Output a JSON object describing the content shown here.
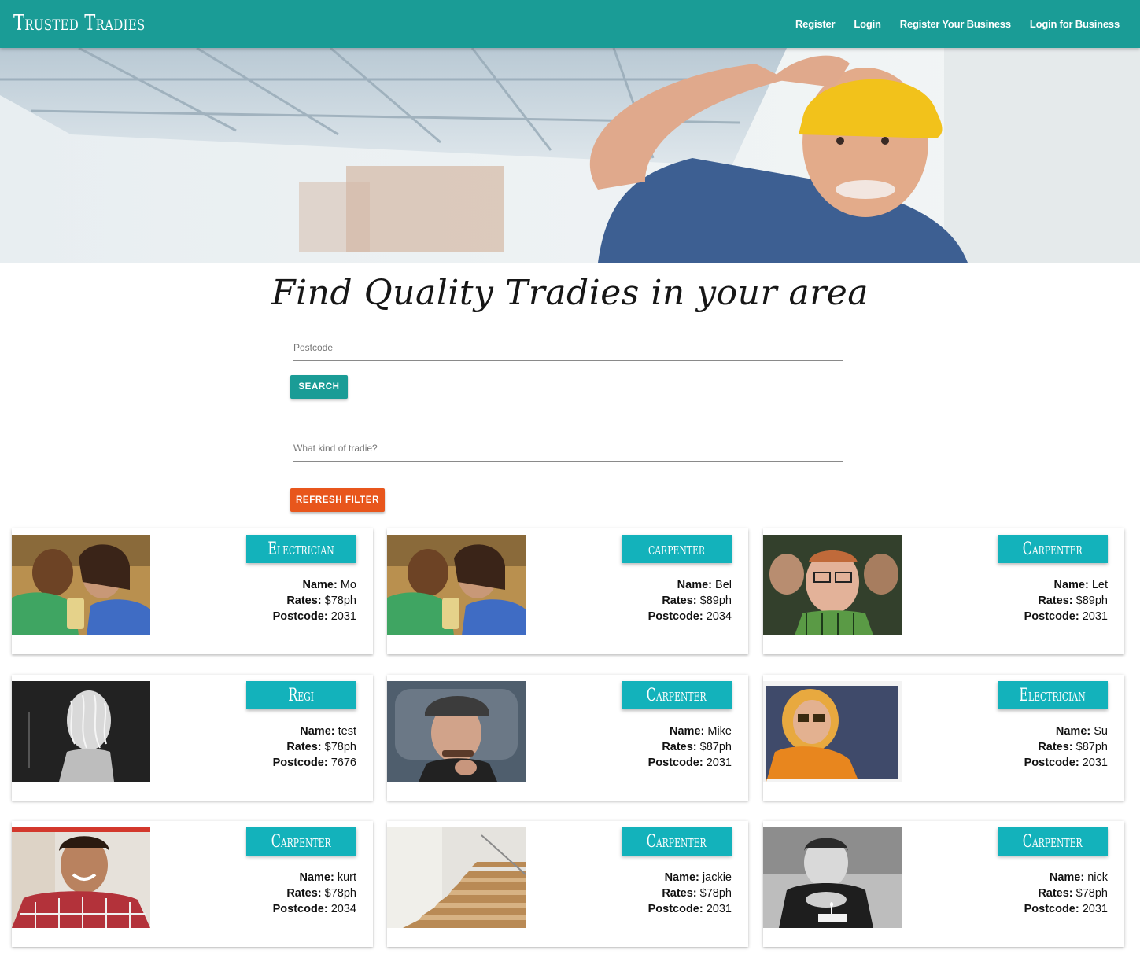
{
  "navbar": {
    "brand": "Trusted Tradies",
    "links": [
      "Register",
      "Login",
      "Register Your Business",
      "Login for Business"
    ]
  },
  "hero": {
    "image": "construction-worker-hardhat-photo"
  },
  "main": {
    "title": "Find Quality Tradies in your area",
    "postcode_placeholder": "Postcode",
    "search_label": "Search",
    "tradie_placeholder": "What kind of tradie?",
    "refresh_label": "Refresh Filter"
  },
  "labels": {
    "name": "Name:",
    "rates": "Rates:",
    "postcode": "Postcode:"
  },
  "cards": [
    {
      "trade": "Electrician",
      "name": "Mo",
      "rate": "$78ph",
      "postcode": "2031",
      "photo": "couple-selfie-photo"
    },
    {
      "trade": "carpenter",
      "name": "Bel",
      "rate": "$89ph",
      "postcode": "2034",
      "photo": "couple-selfie-photo"
    },
    {
      "trade": "Carpenter",
      "name": "Let",
      "rate": "$89ph",
      "postcode": "2031",
      "photo": "three-friends-photo"
    },
    {
      "trade": "Regi",
      "name": "test",
      "rate": "$78ph",
      "postcode": "7676",
      "photo": "costume-wig-photo"
    },
    {
      "trade": "Carpenter",
      "name": "Mike",
      "rate": "$87ph",
      "postcode": "2031",
      "photo": "man-in-cap-photo"
    },
    {
      "trade": "Electrician",
      "name": "Su",
      "rate": "$87ph",
      "postcode": "2031",
      "photo": "woman-sunglasses-photo"
    },
    {
      "trade": "Carpenter",
      "name": "kurt",
      "rate": "$78ph",
      "postcode": "2034",
      "photo": "smiling-man-plaid-photo"
    },
    {
      "trade": "Carpenter",
      "name": "jackie",
      "rate": "$78ph",
      "postcode": "2031",
      "photo": "wooden-stairs-photo"
    },
    {
      "trade": "Carpenter",
      "name": "nick",
      "rate": "$78ph",
      "postcode": "2031",
      "photo": "bw-man-cake-photo"
    }
  ],
  "colors": {
    "primary": "#1a9c96",
    "accent": "#e8561c",
    "badge": "#13b2bb"
  }
}
